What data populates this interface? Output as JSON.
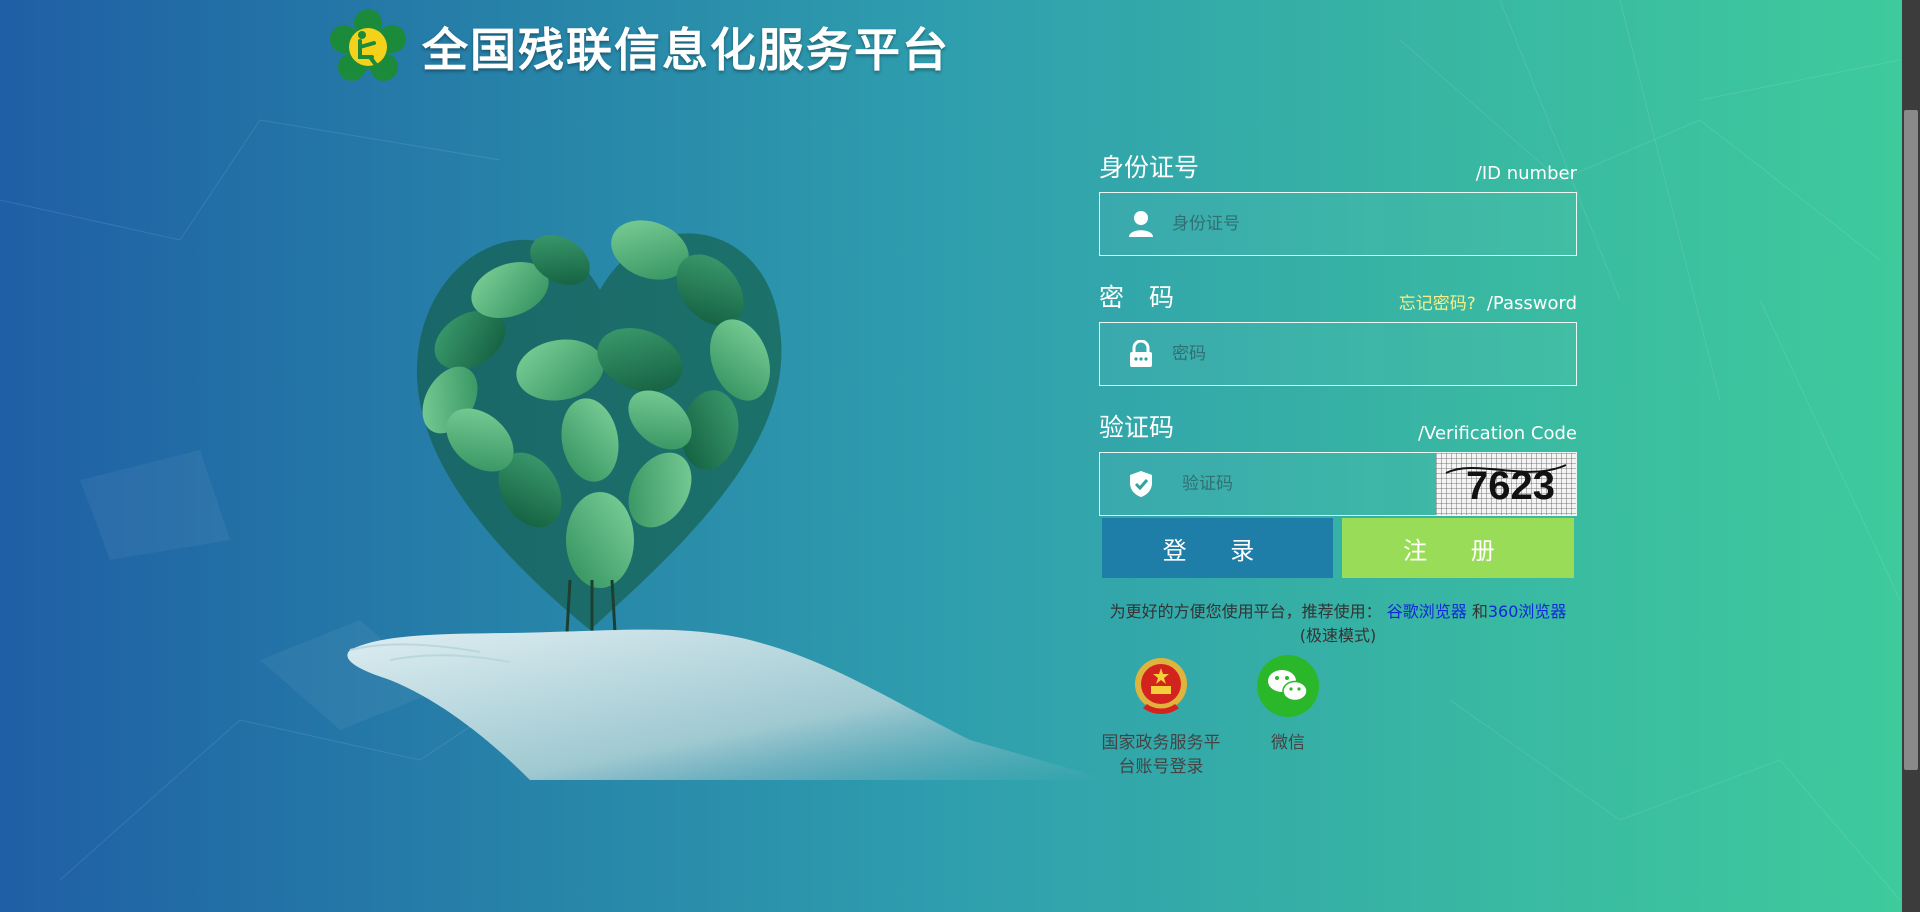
{
  "header": {
    "title": "全国残联信息化服务平台"
  },
  "form": {
    "id": {
      "label_cn": "身份证号",
      "label_en": "/ID number",
      "placeholder": "身份证号"
    },
    "password": {
      "label_cn": "密　码",
      "forgot": "忘记密码?",
      "label_en": "/Password",
      "placeholder": "密码"
    },
    "captcha": {
      "label_cn": "验证码",
      "label_en": "/Verification Code",
      "placeholder": "验证码",
      "code": "7623"
    },
    "login_button": "登 录",
    "register_button": "注 册"
  },
  "tip": {
    "prefix": "为更好的方便您使用平台，推荐使用：",
    "chrome": "谷歌浏览器",
    "and": "和",
    "browser360": "360浏览器",
    "suffix": "(极速模式)"
  },
  "alt_logins": [
    {
      "label": "国家政务服务平台账号登录",
      "icon": "national-emblem-icon"
    },
    {
      "label": "微信",
      "icon": "wechat-icon"
    }
  ],
  "colors": {
    "login": "#1f7ea8",
    "register": "#99dc58",
    "forgot": "#f6f08b",
    "link": "#1029d8"
  }
}
